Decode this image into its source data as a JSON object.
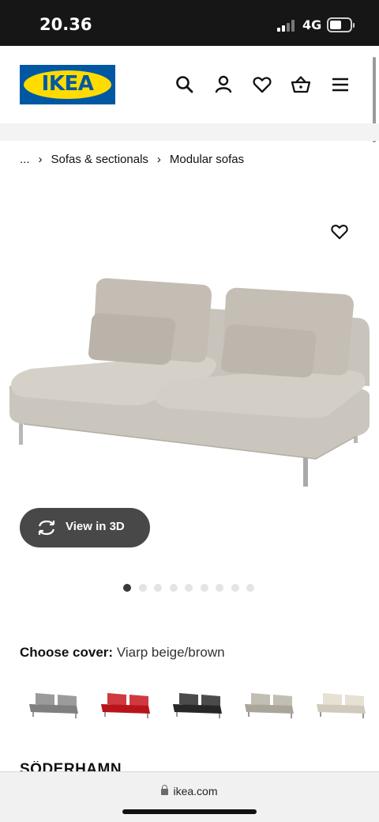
{
  "status_bar": {
    "time": "20.36",
    "network": "4G"
  },
  "header": {
    "logo_text": "IKEA",
    "brand_colors": {
      "blue": "#0058a3",
      "yellow": "#ffdb00"
    }
  },
  "header_icons": [
    "search-icon",
    "account-icon",
    "heart-icon",
    "basket-icon",
    "menu-icon"
  ],
  "breadcrumb": {
    "ellipsis": "...",
    "items": [
      "Sofas & sectionals",
      "Modular sofas"
    ]
  },
  "product": {
    "view3d_label": "View in 3D",
    "carousel": {
      "count": 9,
      "active_index": 0
    },
    "cover_label": "Choose cover:",
    "cover_value": "Viarp beige/brown",
    "swatches": [
      {
        "color": "#8a8a8a"
      },
      {
        "color": "#c8161d"
      },
      {
        "color": "#2b2b2b"
      },
      {
        "color": "#b9b3a6"
      },
      {
        "color": "#e3dccd"
      }
    ],
    "name": "SÖDERHAMN"
  },
  "browser": {
    "url": "ikea.com"
  }
}
